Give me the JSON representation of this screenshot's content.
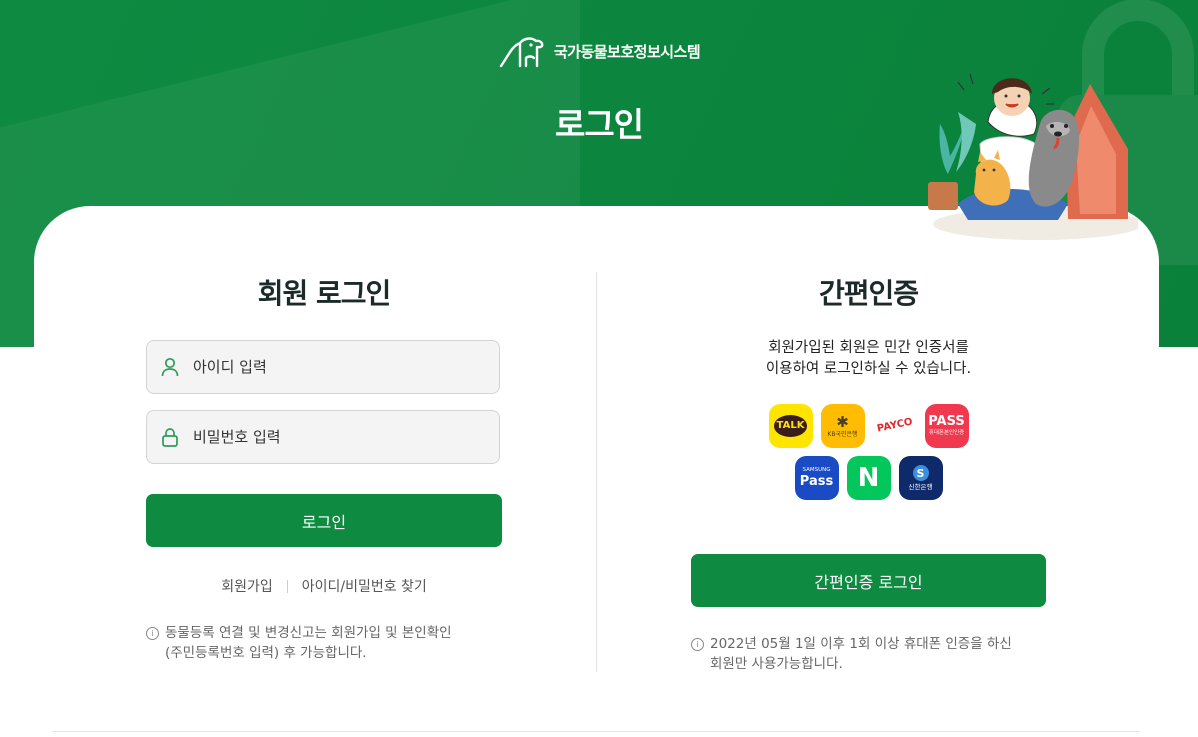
{
  "header": {
    "brand_name": "국가동물보호정보시스템",
    "page_title": "로그인"
  },
  "member_login": {
    "title": "회원 로그인",
    "id_placeholder": "아이디 입력",
    "password_placeholder": "비밀번호 입력",
    "login_button": "로그인",
    "signup_link": "회원가입",
    "find_link": "아이디/비밀번호 찾기",
    "note_line1": "동물등록 연결 및 변경신고는 회원가입 및 본인확인",
    "note_line2": "(주민등록번호 입력) 후 가능합니다."
  },
  "easy_auth": {
    "title": "간편인증",
    "desc_line1": "회원가입된 회원은 민간 인증서를",
    "desc_line2": "이용하여 로그인하실 수 있습니다.",
    "providers": [
      {
        "name": "kakao",
        "label": "TALK",
        "bg": "#fee500",
        "fg": "#3a1d1d"
      },
      {
        "name": "kb",
        "label": "KB국민은행",
        "bg": "#ffbc00",
        "fg": "#4a3f2a"
      },
      {
        "name": "payco",
        "label": "PAYCO",
        "bg": "#ffffff",
        "fg": "#e5262a"
      },
      {
        "name": "pass",
        "label": "PASS",
        "sub": "휴대폰본인인증",
        "bg": "#f0394f",
        "fg": "#ffffff"
      },
      {
        "name": "samsung-pass",
        "label": "Pass",
        "sub": "SAMSUNG",
        "bg": "#1a4bc4",
        "fg": "#ffffff"
      },
      {
        "name": "naver",
        "label": "N",
        "bg": "#03c75a",
        "fg": "#ffffff"
      },
      {
        "name": "shinhan",
        "label": "신한은행",
        "bg": "#0f2a6b",
        "fg": "#ffffff"
      }
    ],
    "login_button": "간편인증 로그인",
    "note_line1": "2022년 05월 1일 이후 1회 이상 휴대폰 인증을 하신",
    "note_line2": "회원만 사용가능합니다."
  },
  "colors": {
    "brand_green": "#0f8a41",
    "field_bg": "#f4f4f4"
  }
}
